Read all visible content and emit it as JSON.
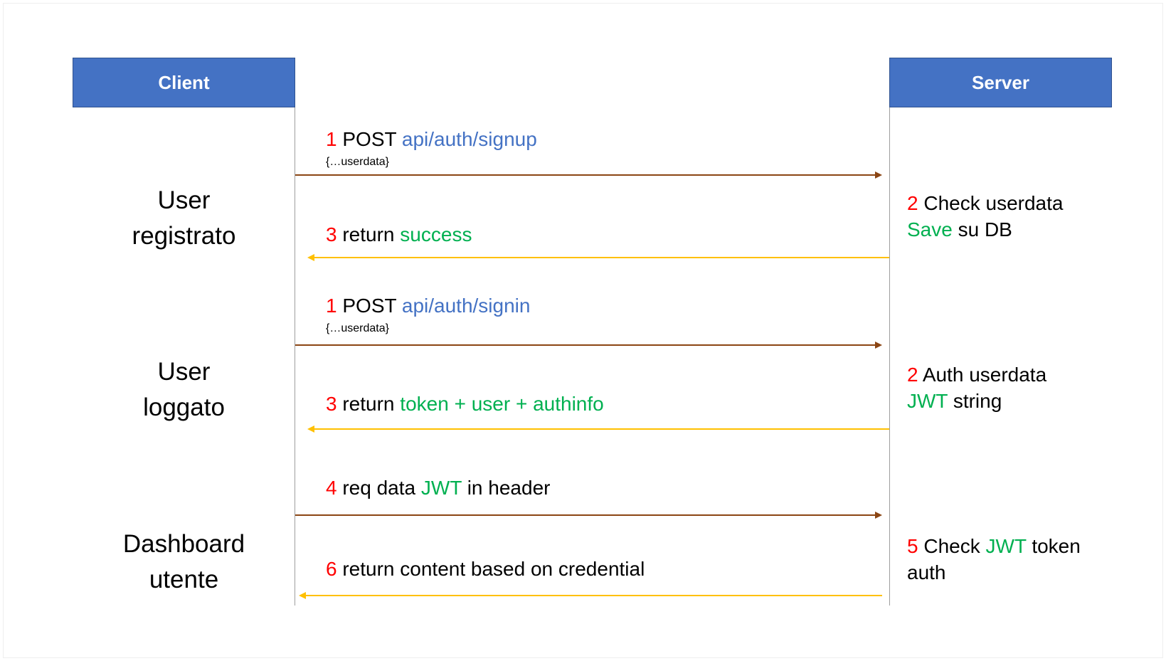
{
  "lanes": {
    "client": "Client",
    "server": "Server"
  },
  "sections": [
    {
      "line1": "User",
      "line2": "registrato"
    },
    {
      "line1": "User",
      "line2": "loggato"
    },
    {
      "line1": "Dashboard",
      "line2": "utente"
    }
  ],
  "messages": {
    "signup": {
      "num": "1",
      "verb": "POST",
      "url": "api/auth/signup",
      "payload": "{…userdata}"
    },
    "signup_return": {
      "num": "3",
      "text": "return",
      "status": "success"
    },
    "signin": {
      "num": "1",
      "verb": "POST",
      "url": "api/auth/signin",
      "payload": "{…userdata}"
    },
    "signin_return": {
      "num": "3",
      "text": "return",
      "status": "token + user + authinfo"
    },
    "req_data": {
      "num": "4",
      "pre": "req data",
      "jwt": "JWT",
      "post": "in header"
    },
    "content_return": {
      "num": "6",
      "text": "return content based on credential"
    }
  },
  "server_notes": {
    "signup": {
      "num": "2",
      "line1": "Check userdata",
      "save": "Save",
      "line2": "su DB"
    },
    "signin": {
      "num": "2",
      "line1": "Auth userdata",
      "jwt": "JWT",
      "line2": "string"
    },
    "dashboard": {
      "num": "5",
      "pre": "Check",
      "jwt": "JWT",
      "post": "token",
      "line2": "auth"
    }
  },
  "colors": {
    "header_fill": "#4472c4",
    "step_number": "#ff0000",
    "url": "#4472c4",
    "highlight": "#00b050",
    "request_arrow": "#8b4513",
    "response_arrow": "#ffc000"
  }
}
